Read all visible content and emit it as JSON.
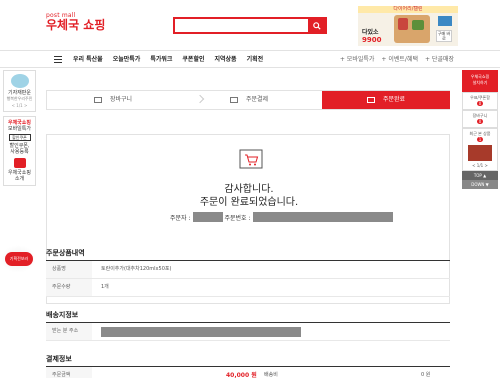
{
  "header": {
    "logo_small": "post",
    "logo_small_suffix": "mall",
    "logo_big": "우체국 쇼핑",
    "search_placeholder": "",
    "banner_top": "다이어리/캘린",
    "banner_line1": "다있소",
    "banner_line2": "9900",
    "banner_go": "구매 바로"
  },
  "nav": {
    "items": [
      "우리 특산물",
      "오늘만특가",
      "특가워크",
      "쿠폰할인",
      "지역상품",
      "기획전"
    ],
    "right": [
      "+ 모바일특가",
      "+ 이벤트/혜택",
      "+ 단골매장"
    ]
  },
  "left_sidebar": {
    "box1_title": "기자재판운",
    "box1_sub": "행복한우리주민",
    "box1_page": "< 1/1 >",
    "box2_logo": "우체국쇼핑",
    "box2_label": "모바일특가",
    "box3_logo": "할인쿠폰",
    "box3_label1": "할인쿠폰,",
    "box3_label2": "사용등록",
    "box4_label1": "우체국쇼핑",
    "box4_label2": "소개",
    "badge": "기획전보러"
  },
  "right_sidebar": {
    "top1": "우체국쇼핑",
    "top2": "설치하기",
    "item1": "우표/쿠폰함",
    "item1_count": "0",
    "item2": "장바구니",
    "item2_count": "0",
    "item3": "최근 본 상품",
    "item3_count": "1",
    "pager": "< 1/1 >",
    "top_btn": "TOP ▲",
    "down_btn": "DOWN ▼"
  },
  "steps": {
    "s1": "장바구니",
    "s2": "주문결제",
    "s3": "주문완료"
  },
  "done": {
    "line1": "감사합니다.",
    "line2": "주문이 완료되었습니다.",
    "orderer_label": "주문자 :",
    "order_no_label": "주문번호 :"
  },
  "order_items": {
    "title": "주문상품내역",
    "name_label": "상품명",
    "name_value": "토란이추가(대추차120mlx50포)",
    "qty_label": "주문수량",
    "qty_value": "1개"
  },
  "shipping": {
    "title": "배송지정보",
    "addr_label": "받는 분 주소"
  },
  "payment": {
    "title": "결제정보",
    "amount_label": "주문금액",
    "amount_value": "40,000 원",
    "delivery_label": "배송비",
    "delivery_value": "0 원"
  },
  "colors": {
    "brand": "#e21f26"
  }
}
